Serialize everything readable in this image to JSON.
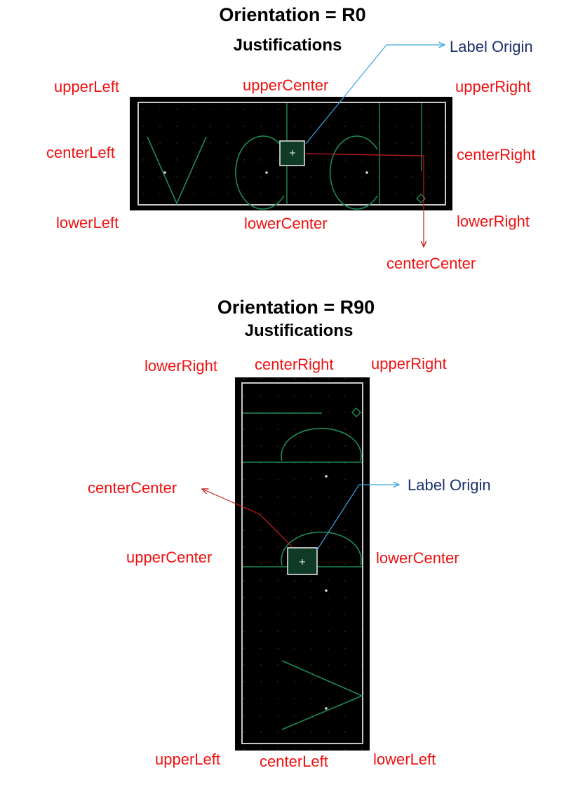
{
  "figure1": {
    "title": "Orientation = R0",
    "subtitle": "Justifications",
    "labels": {
      "upper_left": "upperLeft",
      "upper_center": "upperCenter",
      "upper_right": "upperRight",
      "center_left": "centerLeft",
      "center_right": "centerRight",
      "lower_left": "lowerLeft",
      "lower_center": "lowerCenter",
      "lower_right": "lowerRight",
      "center_center": "centerCenter",
      "label_origin": "Label Origin"
    }
  },
  "figure2": {
    "title": "Orientation = R90",
    "subtitle": "Justifications",
    "labels": {
      "lower_right": "lowerRight",
      "center_right": "centerRight",
      "upper_right": "upperRight",
      "center_center": "centerCenter",
      "label_origin": "Label Origin",
      "upper_center": "upperCenter",
      "lower_center": "lowerCenter",
      "upper_left": "upperLeft",
      "center_left": "centerLeft",
      "lower_left": "lowerLeft"
    }
  },
  "colors": {
    "label_red": "#ee1111",
    "origin_navy": "#1a2f6e",
    "leader_blue": "#3aa6e0",
    "leader_red": "#c81e1e",
    "canvas": "#000000",
    "frame": "#c8c8c8",
    "glyph": "#1f8a55"
  }
}
